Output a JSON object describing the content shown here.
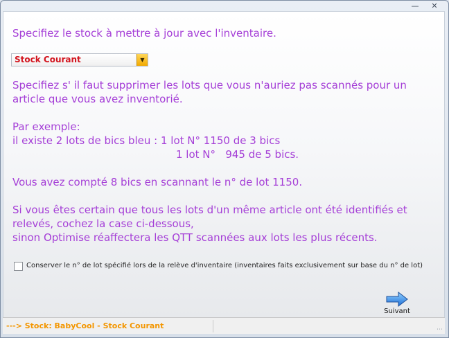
{
  "window": {
    "controls": {
      "minimize_icon": "minimize-icon",
      "close_icon": "close-icon"
    }
  },
  "instructions": {
    "stock_prompt": "Specifiez le stock à mettre à jour avec l'inventaire.",
    "lots_prompt_line1": "Specifiez s' il faut supprimer les lots que vous n'auriez pas scannés pour un",
    "lots_prompt_line2": "article que vous avez inventorié.",
    "example_title": "Par exemple:",
    "example_line1": "il existe 2 lots de bics bleu : 1 lot N° 1150 de 3 bics",
    "example_line2": "1 lot N°   945 de 5 bics.",
    "counted_line": "Vous avez compté 8 bics en scannant le n° de lot 1150.",
    "certain_line1": "Si vous êtes certain que tous les lots d'un même article ont été identifiés et",
    "certain_line2": "relevés, cochez la case ci-dessous,",
    "certain_line3": "sinon Optimise réaffectera les QTT scannées aux lots les plus récents."
  },
  "stock_select": {
    "selected": "Stock Courant"
  },
  "keep_lot_checkbox": {
    "label": "Conserver le n° de lot spécifié lors de la relève d'inventaire (inventaires faits exclusivement sur base du n° de lot)",
    "checked": false
  },
  "next_button": {
    "label": "Suivant",
    "icon": "right-arrow-icon"
  },
  "statusbar": {
    "text": "---> Stock: BabyCool - Stock Courant"
  },
  "colors": {
    "instruction_text": "#a53fd7",
    "select_text": "#d3151f",
    "status_text": "#f39600"
  }
}
